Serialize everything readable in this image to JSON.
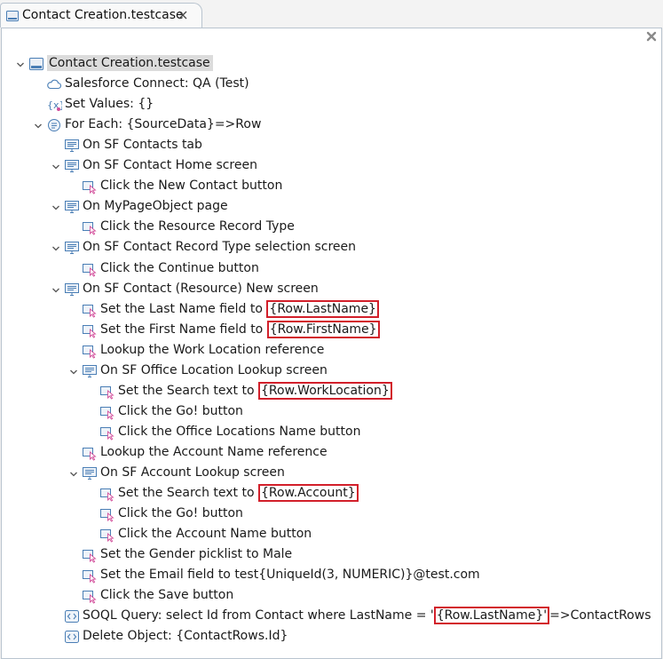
{
  "tab": {
    "title": "Contact Creation.testcase",
    "close_icon": "close-icon"
  },
  "panel": {
    "close_icon": "close-x-icon"
  },
  "tree": [
    {
      "depth": 0,
      "expanded": true,
      "icon": "testcase-icon",
      "text": "Contact Creation.testcase",
      "selected": true
    },
    {
      "depth": 1,
      "expanded": null,
      "icon": "cloud-icon",
      "text": "Salesforce Connect: QA (Test)"
    },
    {
      "depth": 1,
      "expanded": null,
      "icon": "variable-icon",
      "text": "Set Values: {}"
    },
    {
      "depth": 1,
      "expanded": true,
      "icon": "loop-icon",
      "text": "For Each: {SourceData}=>Row"
    },
    {
      "depth": 2,
      "expanded": null,
      "icon": "screen-icon",
      "text": "On SF Contacts tab"
    },
    {
      "depth": 2,
      "expanded": true,
      "icon": "screen-icon",
      "text": "On SF Contact Home screen"
    },
    {
      "depth": 3,
      "expanded": null,
      "icon": "click-icon",
      "text": "Click the New Contact button"
    },
    {
      "depth": 2,
      "expanded": true,
      "icon": "screen-icon",
      "text": "On MyPageObject page"
    },
    {
      "depth": 3,
      "expanded": null,
      "icon": "click-icon",
      "text": "Click the Resource Record Type"
    },
    {
      "depth": 2,
      "expanded": true,
      "icon": "screen-icon",
      "text": "On SF Contact Record Type selection screen"
    },
    {
      "depth": 3,
      "expanded": null,
      "icon": "click-icon",
      "text": "Click the Continue button"
    },
    {
      "depth": 2,
      "expanded": true,
      "icon": "screen-icon",
      "text": "On SF Contact (Resource) New screen"
    },
    {
      "depth": 3,
      "expanded": null,
      "icon": "click-icon",
      "text": "Set the Last Name field to ",
      "highlight": "{Row.LastName}"
    },
    {
      "depth": 3,
      "expanded": null,
      "icon": "click-icon",
      "text": "Set the First Name field to ",
      "highlight": "{Row.FirstName}"
    },
    {
      "depth": 3,
      "expanded": null,
      "icon": "click-icon",
      "text": "Lookup the Work Location reference"
    },
    {
      "depth": 3,
      "expanded": true,
      "icon": "screen-icon",
      "text": "On SF Office Location Lookup screen"
    },
    {
      "depth": 4,
      "expanded": null,
      "icon": "click-icon",
      "text": "Set the Search text to ",
      "highlight": "{Row.WorkLocation}"
    },
    {
      "depth": 4,
      "expanded": null,
      "icon": "click-icon",
      "text": "Click the Go! button"
    },
    {
      "depth": 4,
      "expanded": null,
      "icon": "click-icon",
      "text": "Click the Office Locations Name button"
    },
    {
      "depth": 3,
      "expanded": null,
      "icon": "click-icon",
      "text": "Lookup the Account Name reference"
    },
    {
      "depth": 3,
      "expanded": true,
      "icon": "screen-icon",
      "text": "On SF Account Lookup screen"
    },
    {
      "depth": 4,
      "expanded": null,
      "icon": "click-icon",
      "text": "Set the Search text to ",
      "highlight": "{Row.Account}"
    },
    {
      "depth": 4,
      "expanded": null,
      "icon": "click-icon",
      "text": "Click the Go! button"
    },
    {
      "depth": 4,
      "expanded": null,
      "icon": "click-icon",
      "text": "Click the Account Name button"
    },
    {
      "depth": 3,
      "expanded": null,
      "icon": "click-icon",
      "text": "Set the Gender picklist to Male"
    },
    {
      "depth": 3,
      "expanded": null,
      "icon": "click-icon",
      "text": "Set the Email field to test{UniqueId(3, NUMERIC)}@test.com"
    },
    {
      "depth": 3,
      "expanded": null,
      "icon": "click-icon",
      "text": "Click the Save button"
    },
    {
      "depth": 2,
      "expanded": null,
      "icon": "code-icon",
      "text": "SOQL Query: select Id from Contact where LastName = '",
      "highlight": "{Row.LastName}'",
      "suffix": "=>ContactRows"
    },
    {
      "depth": 2,
      "expanded": null,
      "icon": "code-icon",
      "text": "Delete Object: {ContactRows.Id}"
    }
  ],
  "colors": {
    "highlight_border": "#d21f2a",
    "selection": "#dcdcdc",
    "icon_blue": "#4a7eb5",
    "icon_pink": "#d24d9a"
  }
}
